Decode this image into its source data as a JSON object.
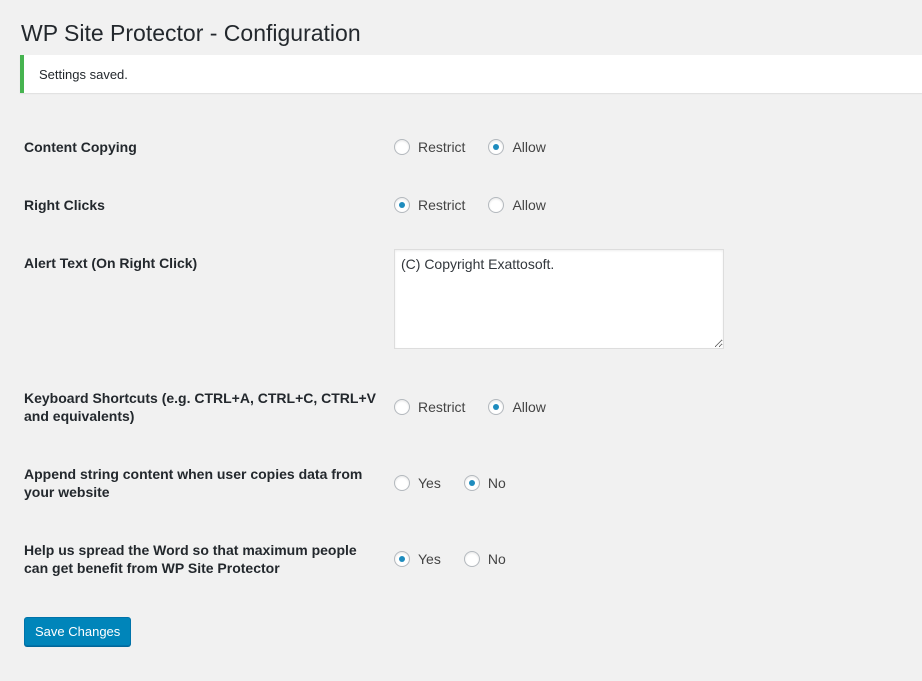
{
  "page": {
    "title": "WP Site Protector - Configuration"
  },
  "notice": {
    "text": "Settings saved.",
    "color": "#46b450"
  },
  "settings": {
    "content_copying": {
      "label": "Content Copying",
      "options": [
        "Restrict",
        "Allow"
      ],
      "selected": "Allow"
    },
    "right_clicks": {
      "label": "Right Clicks",
      "options": [
        "Restrict",
        "Allow"
      ],
      "selected": "Restrict"
    },
    "alert_text": {
      "label": "Alert Text (On Right Click)",
      "value": "(C) Copyright Exattosoft."
    },
    "keyboard_shortcuts": {
      "label": "Keyboard Shortcuts (e.g. CTRL+A, CTRL+C, CTRL+V and equivalents)",
      "options": [
        "Restrict",
        "Allow"
      ],
      "selected": "Allow"
    },
    "append_string": {
      "label": "Append string content when user copies data from your website",
      "options": [
        "Yes",
        "No"
      ],
      "selected": "No"
    },
    "spread_word": {
      "label": "Help us spread the Word so that maximum people can get benefit from WP Site Protector",
      "options": [
        "Yes",
        "No"
      ],
      "selected": "Yes"
    }
  },
  "save_button": {
    "label": "Save Changes",
    "color": "#0085ba"
  },
  "accent_color": "#1e8cbe"
}
